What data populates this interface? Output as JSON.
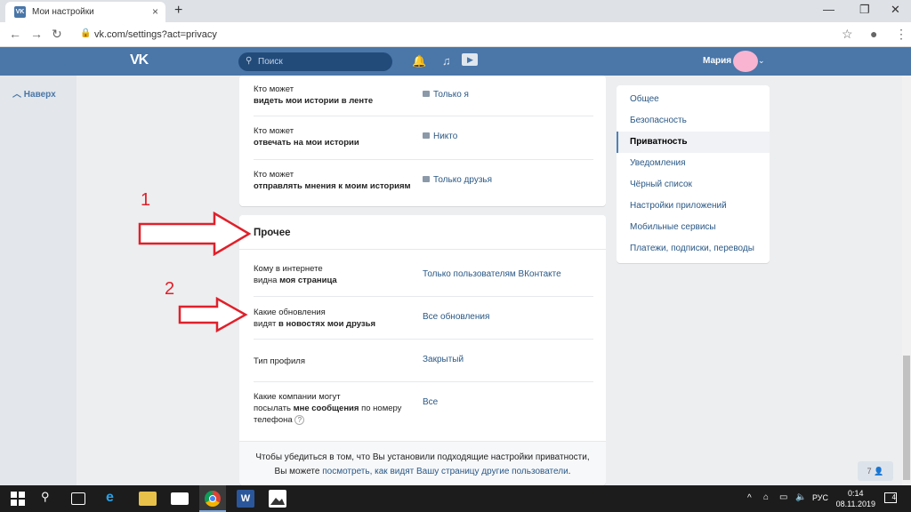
{
  "browser": {
    "tab_title": "Мои настройки",
    "tab_close": "×",
    "new_tab": "+",
    "url": "vk.com/settings?act=privacy",
    "back": "←",
    "forward": "→",
    "reload": "↻",
    "minimize": "—",
    "restore": "❐",
    "close": "✕",
    "star": "☆",
    "account": "●",
    "menu": "⋮"
  },
  "header": {
    "logo": "VK",
    "search_placeholder": "Поиск",
    "user_name": "Мария",
    "accent_color": "#4a76a8"
  },
  "left": {
    "back_label": "Наверх"
  },
  "story_rows": [
    {
      "line1": "Кто может",
      "line2": "видеть мои истории в ленте",
      "value": "Только я"
    },
    {
      "line1": "Кто может",
      "line2": "отвечать на мои истории",
      "value": "Никто"
    },
    {
      "line1": "Кто может",
      "line2": "отправлять мнения к моим историям",
      "value": "Только друзья"
    }
  ],
  "other": {
    "title": "Прочее",
    "rows": [
      {
        "line1": "Кому в интернете",
        "line2a": "видна ",
        "line2b": "моя страница",
        "value": "Только пользователям ВКонтакте"
      },
      {
        "line1": "Какие обновления",
        "line2a": "видят ",
        "line2b": "в новостях мои друзья",
        "value": "Все обновления"
      },
      {
        "line1": "Тип профиля",
        "value": "Закрытый"
      },
      {
        "line1": "Какие компании могут",
        "line2a": "посылать ",
        "line2b": "мне сообщения",
        "line2c": " по номеру",
        "line3": "телефона",
        "value": "Все"
      }
    ],
    "footer_line1": "Чтобы убедиться в том, что Вы установили подходящие настройки приватности,",
    "footer_line2a": "Вы можете ",
    "footer_link": "посмотреть, как видят Вашу страницу другие пользователи",
    "footer_line2b": "."
  },
  "menu": [
    {
      "label": "Общее",
      "active": false
    },
    {
      "label": "Безопасность",
      "active": false
    },
    {
      "label": "Приватность",
      "active": true
    },
    {
      "label": "Уведомления",
      "active": false
    },
    {
      "label": "Чёрный список",
      "active": false
    },
    {
      "label": "Настройки приложений",
      "active": false
    },
    {
      "label": "Мобильные сервисы",
      "active": false
    },
    {
      "label": "Платежи, подписки, переводы",
      "active": false
    }
  ],
  "annotations": {
    "one": "1",
    "two": "2",
    "color": "#e0202a"
  },
  "badge_count": "7",
  "taskbar": {
    "lang": "РУС",
    "time": "0:14",
    "date": "08.11.2019",
    "notif": "4"
  }
}
